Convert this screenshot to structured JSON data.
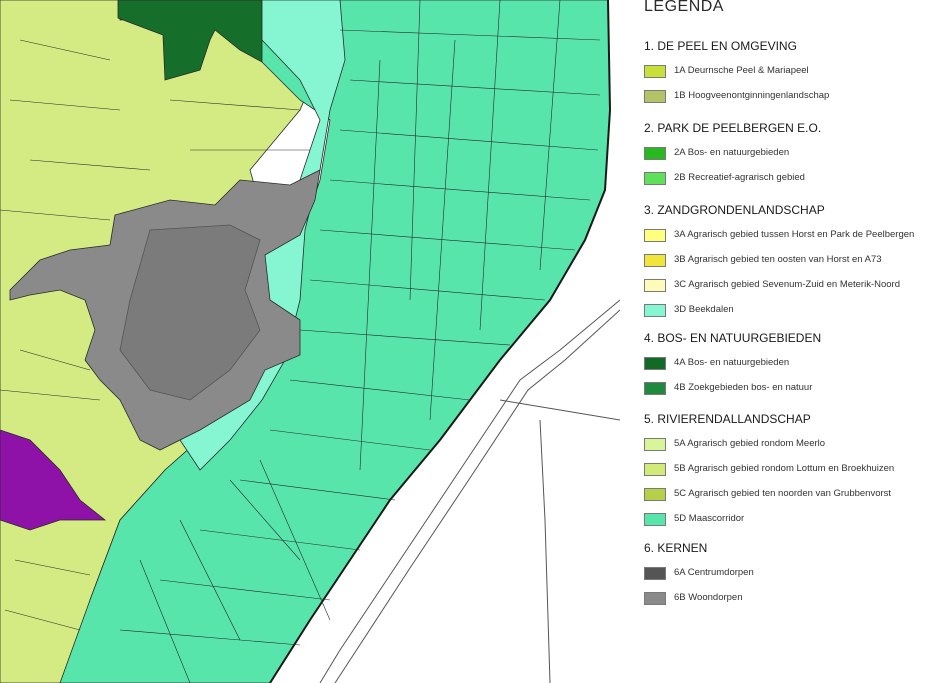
{
  "legend": {
    "title": "LEGENDA",
    "sections": [
      {
        "title": "1.  DE PEEL EN OMGEVING",
        "items": [
          {
            "label": "1A  Deurnsche Peel & Mariapeel",
            "color": "#c9e03a"
          },
          {
            "label": "1B  Hoogveenontginningenlandschap",
            "color": "#b3c366"
          }
        ]
      },
      {
        "title": "2.  PARK DE PEELBERGEN E.O.",
        "items": [
          {
            "label": "2A  Bos- en natuurgebieden",
            "color": "#28b81f"
          },
          {
            "label": "2B  Recreatief-agrarisch gebied",
            "color": "#5ee05a"
          }
        ]
      },
      {
        "title": "3.  ZANDGRONDENLANDSCHAP",
        "items": [
          {
            "label": "3A  Agrarisch gebied tussen Horst en Park de Peelbergen",
            "color": "#ffff80"
          },
          {
            "label": "3B  Agrarisch gebied ten oosten van Horst en A73",
            "color": "#f1e53c"
          },
          {
            "label": "3C  Agrarisch gebied Sevenum-Zuid en Meterik-Noord",
            "color": "#fffbb8"
          },
          {
            "label": "3D  Beekdalen",
            "color": "#86f5d2"
          }
        ]
      },
      {
        "title": "4.  BOS- EN NATUURGEBIEDEN",
        "items": [
          {
            "label": "4A  Bos- en natuurgebieden",
            "color": "#136a27"
          },
          {
            "label": "4B  Zoekgebieden bos- en natuur",
            "color": "#1f8a3c"
          }
        ]
      },
      {
        "title": "5.  RIVIERENDALLANDSCHAP",
        "items": [
          {
            "label": "5A  Agrarisch gebied rondom Meerlo",
            "color": "#d8f59a"
          },
          {
            "label": "5B  Agrarisch gebied rondom Lottum en Broekhuizen",
            "color": "#d2ea78"
          },
          {
            "label": "5C  Agrarisch gebied ten noorden van Grubbenvorst",
            "color": "#b5cf48"
          },
          {
            "label": "5D  Maascorridor",
            "color": "#57e5ac"
          }
        ]
      },
      {
        "title": "6.  KERNEN",
        "items": [
          {
            "label": "6A  Centrumdorpen",
            "color": "#555555"
          },
          {
            "label": "6B  Woondorpen",
            "color": "#8a8a8a"
          }
        ]
      }
    ]
  },
  "map": {
    "colors": {
      "peel": "#d3eb82",
      "forest": "#166e2b",
      "maascorridor": "#57e5ac",
      "beekdalen": "#86f5d2",
      "village": "#8a8a8a",
      "village_dark": "#6f6f6f",
      "purple": "#8e12a8",
      "parcel_line": "#2a2a2a",
      "river_bg": "#ffffff"
    }
  }
}
